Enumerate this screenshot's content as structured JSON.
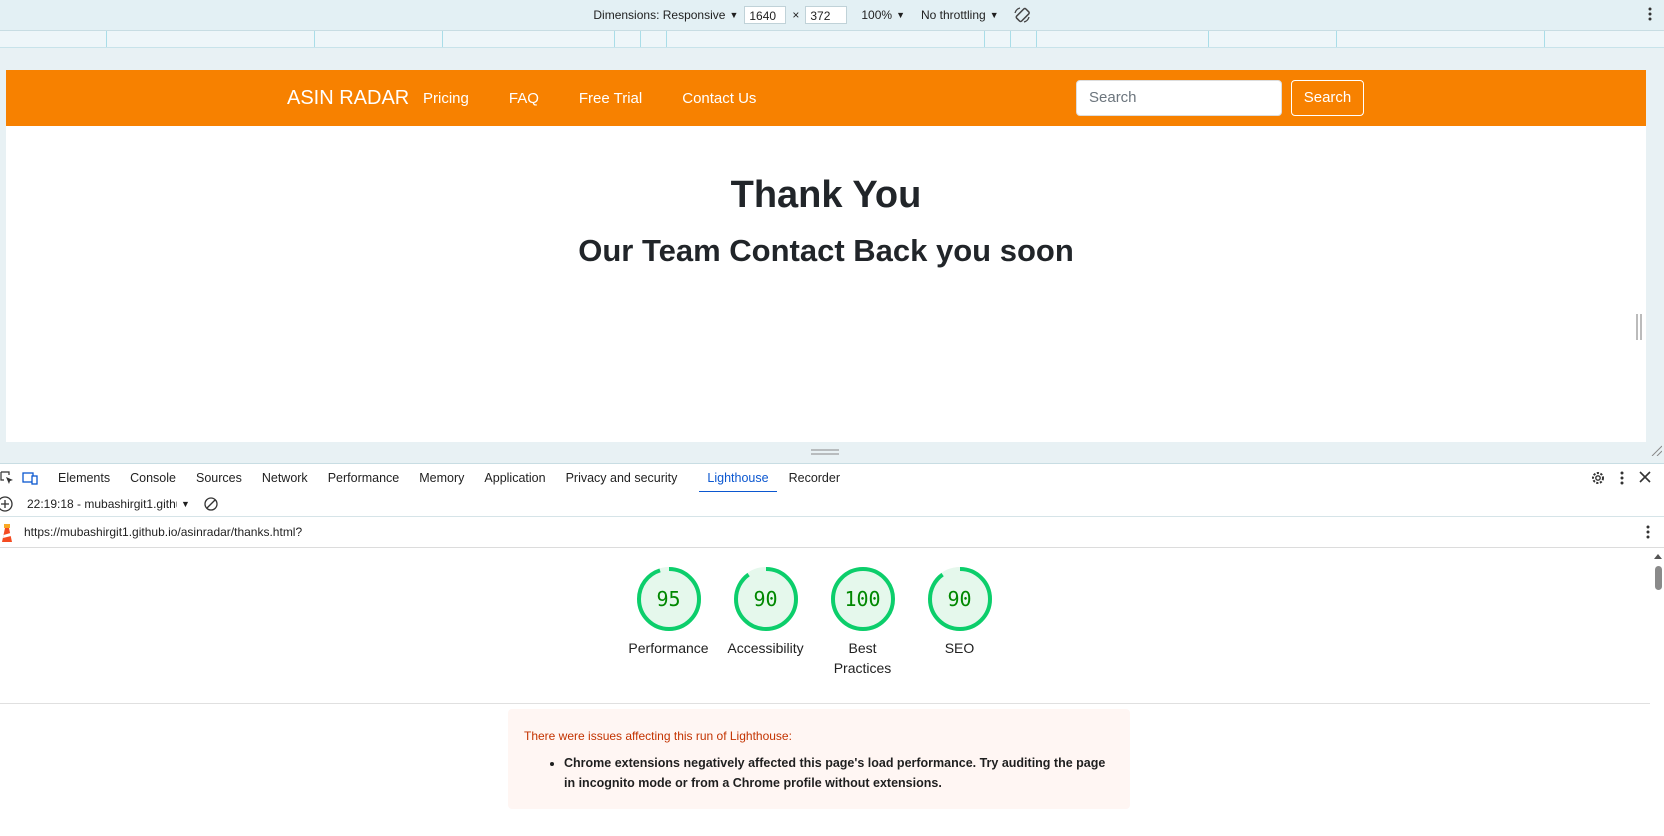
{
  "device_toolbar": {
    "dimensions_label": "Dimensions: Responsive",
    "width": "1640",
    "times": "×",
    "height": "372",
    "zoom": "100%",
    "throttling": "No throttling"
  },
  "site": {
    "brand": "ASIN RADAR",
    "nav": [
      "Pricing",
      "FAQ",
      "Free Trial",
      "Contact Us"
    ],
    "search_placeholder": "Search",
    "search_button": "Search",
    "heading": "Thank You",
    "subheading": "Our Team Contact Back you soon"
  },
  "devtools": {
    "tabs": [
      "Elements",
      "Console",
      "Sources",
      "Network",
      "Performance",
      "Memory",
      "Application",
      "Privacy and security",
      "Lighthouse",
      "Recorder"
    ],
    "active_tab": "Lighthouse",
    "report_selector": "22:19:18 - mubashirgit1.githu",
    "url": "https://mubashirgit1.github.io/asinradar/thanks.html?"
  },
  "lighthouse": {
    "scores": [
      {
        "value": 95,
        "label": "Performance"
      },
      {
        "value": 90,
        "label": "Accessibility"
      },
      {
        "value": 100,
        "label": "Best Practices"
      },
      {
        "value": 90,
        "label": "SEO"
      }
    ],
    "warning_title": "There were issues affecting this run of Lighthouse:",
    "warning_items": [
      "Chrome extensions negatively affected this page's load performance. Try auditing the page in incognito mode or from a Chrome profile without extensions."
    ]
  },
  "colors": {
    "navbar": "#f78100",
    "gauge_pass": "#0cce6b",
    "gauge_text": "#008800",
    "accent": "#0b57d0"
  }
}
